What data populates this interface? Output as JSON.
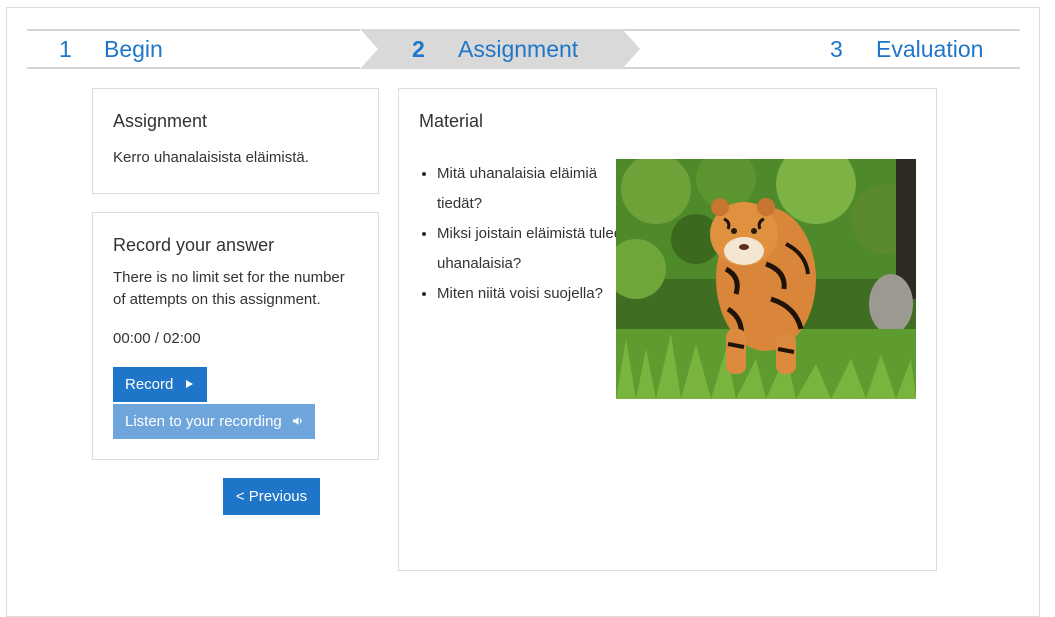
{
  "steps": [
    {
      "number": "1",
      "label": "Begin"
    },
    {
      "number": "2",
      "label": "Assignment"
    },
    {
      "number": "3",
      "label": "Evaluation"
    }
  ],
  "assignment": {
    "title": "Assignment",
    "text": "Kerro uhanalaisista eläimistä."
  },
  "record": {
    "title": "Record your answer",
    "description": "There is no limit set for the number of attempts on this assignment.",
    "time": "00:00 / 02:00",
    "record_label": "Record",
    "listen_label": "Listen to your recording"
  },
  "nav": {
    "previous_label": "< Previous"
  },
  "material": {
    "title": "Material",
    "items": [
      "Mitä uhanalaisia eläimiä tiedät?",
      "Miksi joistain eläimistä tulee uhanalaisia?",
      "Miten niitä voisi suojella?"
    ],
    "image_icon": "tiger-photo"
  },
  "colors": {
    "accent": "#1f76c9",
    "accent_light": "#6ea5dd",
    "step_active_bg": "#d9d9d9",
    "border": "#dcdcdc"
  }
}
